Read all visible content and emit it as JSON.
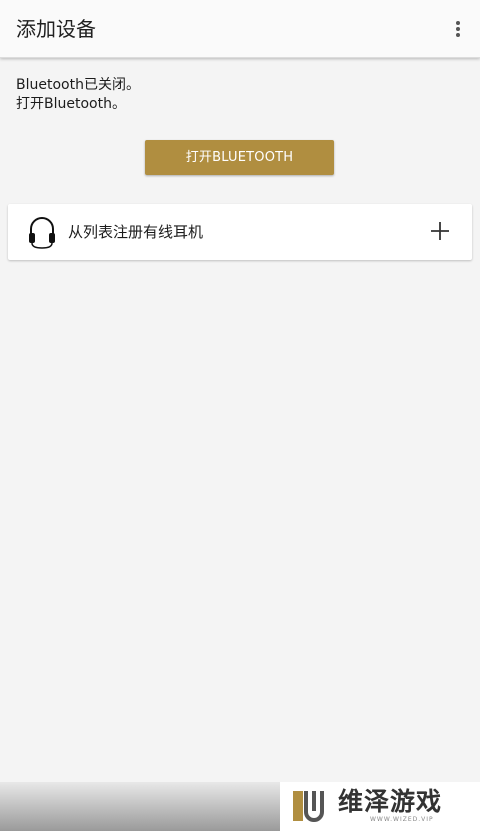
{
  "appbar": {
    "title": "添加设备",
    "overflow_icon": "more-vert-icon"
  },
  "status": {
    "line1": "Bluetooth已关闭。",
    "line2": "打开Bluetooth。"
  },
  "bluetooth_button": {
    "label": "打开BLUETOOTH",
    "color": "#b08e40"
  },
  "wired_card": {
    "icon": "headphones-icon",
    "label": "从列表注册有线耳机",
    "action_icon": "plus-icon"
  },
  "watermark": {
    "title": "维泽游戏",
    "subtitle": "WWW.WIZED.VIP"
  }
}
